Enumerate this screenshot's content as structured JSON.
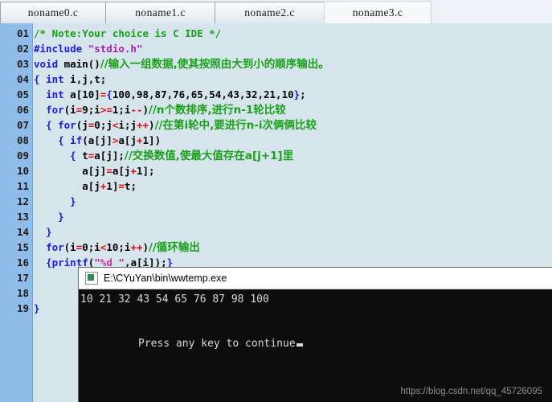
{
  "window": {
    "title": "C IDE editor with console output"
  },
  "tabs": [
    {
      "label": "noname0.c",
      "active": false
    },
    {
      "label": "noname1.c",
      "active": false
    },
    {
      "label": "noname2.c",
      "active": false
    },
    {
      "label": "noname3.c",
      "active": true
    }
  ],
  "editor": {
    "line_numbers": [
      "01",
      "02",
      "03",
      "04",
      "05",
      "06",
      "07",
      "08",
      "09",
      "10",
      "11",
      "12",
      "13",
      "14",
      "15",
      "16",
      "17",
      "18",
      "19"
    ],
    "lines": [
      {
        "n": "01",
        "tokens": [
          {
            "t": "/* Note:Your choice is C IDE */",
            "c": "cmt"
          }
        ]
      },
      {
        "n": "02",
        "tokens": [
          {
            "t": "#include ",
            "c": "pre"
          },
          {
            "t": "\"stdio.h\"",
            "c": "str"
          }
        ]
      },
      {
        "n": "03",
        "tokens": [
          {
            "t": "void",
            "c": "kw"
          },
          {
            "t": " main()",
            "c": "plain"
          },
          {
            "t": "//输入一组数据,使其按照由大到小的顺序输出。",
            "c": "cmt cjk"
          }
        ]
      },
      {
        "n": "04",
        "tokens": [
          {
            "t": "{",
            "c": "brc"
          },
          {
            "t": " ",
            "c": "plain"
          },
          {
            "t": "int",
            "c": "kw"
          },
          {
            "t": " i,j,t;",
            "c": "plain"
          }
        ]
      },
      {
        "n": "05",
        "tokens": [
          {
            "t": "  ",
            "c": "plain"
          },
          {
            "t": "int",
            "c": "kw"
          },
          {
            "t": " a[10]",
            "c": "plain"
          },
          {
            "t": "=",
            "c": "op"
          },
          {
            "t": "{",
            "c": "brc"
          },
          {
            "t": "100,98,87,76,65,54,43,32,21,10",
            "c": "plain"
          },
          {
            "t": "}",
            "c": "brc"
          },
          {
            "t": ";",
            "c": "plain"
          }
        ]
      },
      {
        "n": "06",
        "tokens": [
          {
            "t": "  ",
            "c": "plain"
          },
          {
            "t": "for",
            "c": "kw"
          },
          {
            "t": "(i",
            "c": "plain"
          },
          {
            "t": "=",
            "c": "op"
          },
          {
            "t": "9;i",
            "c": "plain"
          },
          {
            "t": ">=",
            "c": "op"
          },
          {
            "t": "1;i",
            "c": "plain"
          },
          {
            "t": "--",
            "c": "op"
          },
          {
            "t": ")",
            "c": "plain"
          },
          {
            "t": "//n个数排序,进行n-1轮比较",
            "c": "cmt cjk"
          }
        ]
      },
      {
        "n": "07",
        "tokens": [
          {
            "t": "  ",
            "c": "plain"
          },
          {
            "t": "{",
            "c": "brc"
          },
          {
            "t": " ",
            "c": "plain"
          },
          {
            "t": "for",
            "c": "kw"
          },
          {
            "t": "(j",
            "c": "plain"
          },
          {
            "t": "=",
            "c": "op"
          },
          {
            "t": "0;j",
            "c": "plain"
          },
          {
            "t": "<",
            "c": "op"
          },
          {
            "t": "i;j",
            "c": "plain"
          },
          {
            "t": "++",
            "c": "op"
          },
          {
            "t": ")",
            "c": "plain"
          },
          {
            "t": "//在第i轮中,要进行n-i次俩俩比较",
            "c": "cmt cjk"
          }
        ]
      },
      {
        "n": "08",
        "tokens": [
          {
            "t": "    ",
            "c": "plain"
          },
          {
            "t": "{",
            "c": "brc"
          },
          {
            "t": " ",
            "c": "plain"
          },
          {
            "t": "if",
            "c": "kw"
          },
          {
            "t": "(a[j]",
            "c": "plain"
          },
          {
            "t": ">",
            "c": "op"
          },
          {
            "t": "a[j",
            "c": "plain"
          },
          {
            "t": "+",
            "c": "op"
          },
          {
            "t": "1])",
            "c": "plain"
          }
        ]
      },
      {
        "n": "09",
        "tokens": [
          {
            "t": "      ",
            "c": "plain"
          },
          {
            "t": "{",
            "c": "brc"
          },
          {
            "t": " t",
            "c": "plain"
          },
          {
            "t": "=",
            "c": "op"
          },
          {
            "t": "a[j];",
            "c": "plain"
          },
          {
            "t": "//交换数值,使最大值存在a[j+1]里",
            "c": "cmt cjk"
          }
        ]
      },
      {
        "n": "10",
        "tokens": [
          {
            "t": "        a[j]",
            "c": "plain"
          },
          {
            "t": "=",
            "c": "op"
          },
          {
            "t": "a[j",
            "c": "plain"
          },
          {
            "t": "+",
            "c": "op"
          },
          {
            "t": "1];",
            "c": "plain"
          }
        ]
      },
      {
        "n": "11",
        "tokens": [
          {
            "t": "        a[j",
            "c": "plain"
          },
          {
            "t": "+",
            "c": "op"
          },
          {
            "t": "1]",
            "c": "plain"
          },
          {
            "t": "=",
            "c": "op"
          },
          {
            "t": "t;",
            "c": "plain"
          }
        ]
      },
      {
        "n": "12",
        "tokens": [
          {
            "t": "      ",
            "c": "plain"
          },
          {
            "t": "}",
            "c": "brc"
          }
        ]
      },
      {
        "n": "13",
        "tokens": [
          {
            "t": "    ",
            "c": "plain"
          },
          {
            "t": "}",
            "c": "brc"
          }
        ]
      },
      {
        "n": "14",
        "tokens": [
          {
            "t": "  ",
            "c": "plain"
          },
          {
            "t": "}",
            "c": "brc"
          }
        ]
      },
      {
        "n": "15",
        "tokens": [
          {
            "t": "  ",
            "c": "plain"
          },
          {
            "t": "for",
            "c": "kw"
          },
          {
            "t": "(i",
            "c": "plain"
          },
          {
            "t": "=",
            "c": "op"
          },
          {
            "t": "0;i",
            "c": "plain"
          },
          {
            "t": "<",
            "c": "op"
          },
          {
            "t": "10;i",
            "c": "plain"
          },
          {
            "t": "++",
            "c": "op"
          },
          {
            "t": ")",
            "c": "plain"
          },
          {
            "t": "//循环输出",
            "c": "cmt cjk"
          }
        ]
      },
      {
        "n": "16",
        "tokens": [
          {
            "t": "  ",
            "c": "plain"
          },
          {
            "t": "{",
            "c": "brc"
          },
          {
            "t": "printf",
            "c": "kw"
          },
          {
            "t": "(",
            "c": "plain"
          },
          {
            "t": "\"",
            "c": "str"
          },
          {
            "t": "%d",
            "c": "fmt"
          },
          {
            "t": " \"",
            "c": "str"
          },
          {
            "t": ",a[i]);",
            "c": "plain"
          },
          {
            "t": "}",
            "c": "brc"
          }
        ]
      },
      {
        "n": "17",
        "tokens": []
      },
      {
        "n": "18",
        "tokens": []
      },
      {
        "n": "19",
        "tokens": [
          {
            "t": "}",
            "c": "brc"
          }
        ]
      }
    ]
  },
  "console": {
    "title": "E:\\CYuYan\\bin\\wwtemp.exe",
    "icon": "console-app-icon",
    "output_line": "10 21 32 43 54 65 76 87 98 100",
    "prompt": "Press any key to continue"
  },
  "watermark": "https://blog.csdn.net/qq_45726095",
  "colors": {
    "gutter_bg": "#90bce9",
    "editor_bg": "#d6e4ec",
    "tabbar_bg": "#eef2f6",
    "active_tab_bg": "#f7f9fa",
    "console_bg": "#0d0d0d",
    "comment": "#1aa11a",
    "keyword": "#1c1cd9",
    "string": "#a91fa9",
    "operator": "#e01010"
  }
}
